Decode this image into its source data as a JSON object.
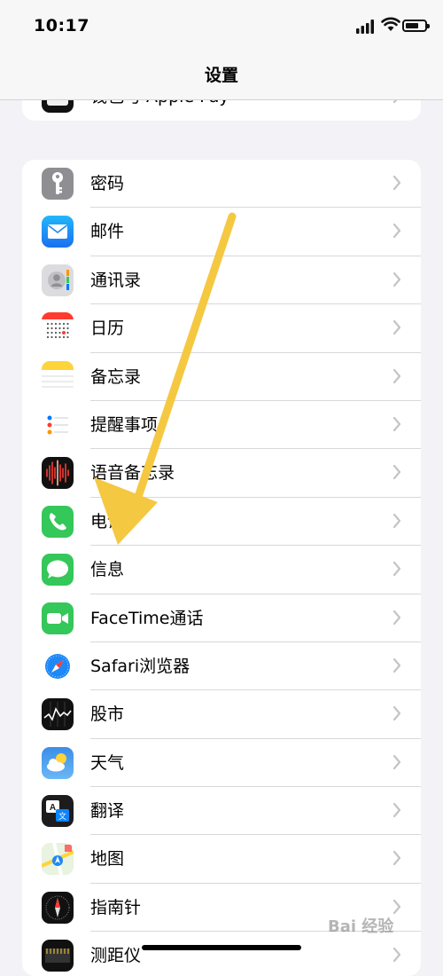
{
  "status_bar": {
    "time": "10:17"
  },
  "nav": {
    "title": "设置"
  },
  "wallet_row": {
    "label": "钱包与 Apple Pay"
  },
  "items": [
    {
      "label": "密码",
      "icon": "key-icon",
      "color": "#8e8e93"
    },
    {
      "label": "邮件",
      "icon": "mail-icon",
      "color": "#1e88f7"
    },
    {
      "label": "通讯录",
      "icon": "contacts-icon",
      "color": "#d8d8dc"
    },
    {
      "label": "日历",
      "icon": "calendar-icon",
      "color": "#ffffff"
    },
    {
      "label": "备忘录",
      "icon": "notes-icon",
      "color": "#ffffff"
    },
    {
      "label": "提醒事项",
      "icon": "reminders-icon",
      "color": "#ffffff"
    },
    {
      "label": "语音备忘录",
      "icon": "voice-memos-icon",
      "color": "#111111"
    },
    {
      "label": "电话",
      "icon": "phone-icon",
      "color": "#34c759"
    },
    {
      "label": "信息",
      "icon": "messages-icon",
      "color": "#34c759"
    },
    {
      "label": "FaceTime通话",
      "icon": "facetime-icon",
      "color": "#34c759"
    },
    {
      "label": "Safari浏览器",
      "icon": "safari-icon",
      "color": "#ffffff"
    },
    {
      "label": "股市",
      "icon": "stocks-icon",
      "color": "#111111"
    },
    {
      "label": "天气",
      "icon": "weather-icon",
      "color": "#2f80ed"
    },
    {
      "label": "翻译",
      "icon": "translate-icon",
      "color": "#1c1c1e"
    },
    {
      "label": "地图",
      "icon": "maps-icon",
      "color": "#e8f3e0"
    },
    {
      "label": "指南针",
      "icon": "compass-icon",
      "color": "#111111"
    },
    {
      "label": "测距仪",
      "icon": "measure-icon",
      "color": "#111111"
    }
  ],
  "watermark": "Bai 经验",
  "arrow_color": "#f5c842"
}
